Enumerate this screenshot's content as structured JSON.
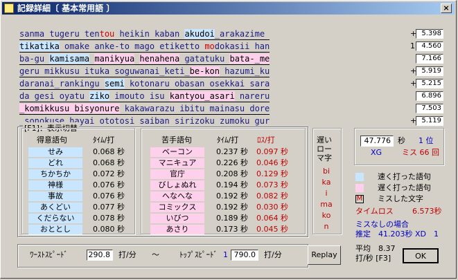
{
  "title": "記録詳細〔 基本常用語 〕",
  "close_glyph": "×",
  "rows": [
    {
      "segments": [
        {
          "t": "sanma tugeru ten",
          "c": "norm"
        },
        {
          "t": "tou",
          "c": "miss"
        },
        {
          "t": " heikin kaban ",
          "c": "norm"
        },
        {
          "t": "akudoi",
          "c": "fast"
        },
        {
          "t": "_arakazime ",
          "c": "norm"
        }
      ],
      "plus": "+",
      "value": "5.398"
    },
    {
      "segments": [
        {
          "t": "tikatika",
          "c": "fast"
        },
        {
          "t": " omake anke-to mago etiketto ",
          "c": "norm"
        },
        {
          "t": "mo",
          "c": "miss"
        },
        {
          "t": "dokasii han",
          "c": "norm"
        }
      ],
      "plus": "1",
      "value": "4.560"
    },
    {
      "segments": [
        {
          "t": "ba-gu ",
          "c": "norm"
        },
        {
          "t": "kamisama",
          "c": "fast"
        },
        {
          "t": " ",
          "c": "norm"
        },
        {
          "t": "manikyua",
          "c": "slow"
        },
        {
          "t": " ",
          "c": "norm"
        },
        {
          "t": "henahena",
          "c": "slow"
        },
        {
          "t": " gatatuku ",
          "c": "norm"
        },
        {
          "t": "bata-_me",
          "c": "slow"
        }
      ],
      "plus": "",
      "value": "7.166"
    },
    {
      "segments": [
        {
          "t": "geru mikkusu ituka soguwanai_keti_",
          "c": "norm"
        },
        {
          "t": "be-kon",
          "c": "slow"
        },
        {
          "t": " hazumi_ku",
          "c": "norm"
        }
      ],
      "plus": "+",
      "value": "5.919"
    },
    {
      "segments": [
        {
          "t": "daranai_rankingu ",
          "c": "norm"
        },
        {
          "t": "semi",
          "c": "fast"
        },
        {
          "t": " kotonaru obasan osekkai sara",
          "c": "norm"
        }
      ],
      "plus": "+",
      "value": "5.215"
    },
    {
      "segments": [
        {
          "t": "da gesi oyatu ",
          "c": "norm"
        },
        {
          "t": "ziko",
          "c": "fast"
        },
        {
          "t": " imouto isu ",
          "c": "norm"
        },
        {
          "t": "kantyou_asari",
          "c": "slow"
        },
        {
          "t": " nareru",
          "c": "norm"
        }
      ],
      "plus": "",
      "value": "6.896"
    },
    {
      "segments": [
        {
          "t": "_komikkusu bisyonure",
          "c": "slow"
        },
        {
          "t": " kakawarazu ibitu mainasu dore",
          "c": "norm"
        }
      ],
      "plus": "",
      "value": "7.503"
    },
    {
      "segments": [
        {
          "t": "_sonokuse hayai ototosi saiban sirizoku zumoku gur",
          "c": "norm"
        }
      ],
      "plus": "+",
      "value": "5.119"
    }
  ],
  "panel": {
    "label": "[F1]：表示切替",
    "good_header": "得意語句",
    "good_col": "ﾀｲﾑ/打",
    "good": [
      {
        "w": "せみ",
        "v": "0.068 秒"
      },
      {
        "w": "どれ",
        "v": "0.068 秒"
      },
      {
        "w": "ちかちか",
        "v": "0.072 秒"
      },
      {
        "w": "神様",
        "v": "0.076 秒"
      },
      {
        "w": "事故",
        "v": "0.076 秒"
      },
      {
        "w": "あくどい",
        "v": "0.077 秒"
      },
      {
        "w": "くだらない",
        "v": "0.078 秒"
      },
      {
        "w": "おととし",
        "v": "0.080 秒"
      }
    ],
    "bad_header": "苦手語句",
    "bad_col": "ﾀｲﾑ/打",
    "bad_loss_col": "ﾛｽ/打",
    "bad": [
      {
        "w": "ベーコン",
        "v": "0.237 秒",
        "l": "0.097 秒"
      },
      {
        "w": "マニキュア",
        "v": "0.226 秒",
        "l": "0.046 秒"
      },
      {
        "w": "官庁",
        "v": "0.208 秒",
        "l": "0.129 秒"
      },
      {
        "w": "びしょぬれ",
        "v": "0.194 秒",
        "l": "0.073 秒"
      },
      {
        "w": "へなへな",
        "v": "0.192 秒",
        "l": "0.082 秒"
      },
      {
        "w": "コミックス",
        "v": "0.192 秒",
        "l": "0.030 秒"
      },
      {
        "w": "いびつ",
        "v": "0.189 秒",
        "l": "0.064 秒"
      },
      {
        "w": "あさり",
        "v": "0.173 秒",
        "l": "0.045 秒"
      }
    ],
    "slow_keys_header": [
      "遅い",
      "ロー",
      "マ字"
    ],
    "slow_keys": [
      "bi",
      "ka",
      "i",
      "ma",
      "ko",
      "n"
    ]
  },
  "result": {
    "time": "47.776",
    "sec_unit": "秒",
    "rank": "1 位",
    "xg": "XG",
    "miss": "ミス 66 回"
  },
  "legend": {
    "fast": "速く打った語句",
    "slow": "遅く打った語句",
    "miss_mark": "M",
    "miss": "ミスした文字",
    "timeloss_label": "タイムロス",
    "timeloss_value": "6.573秒",
    "nomiss_label": "ミスなしの場合",
    "estimate": "推定　41.203秒 XD　1"
  },
  "speed": {
    "worst_label": "ﾜｰｽﾄｽﾋﾟｰﾄﾞ",
    "worst_value": "290.8",
    "unit": "打/分",
    "tilde": "～",
    "top_label": "ﾄｯﾌﾟｽﾋﾟｰﾄﾞ",
    "top_rank": "1",
    "top_value": "790.0"
  },
  "buttons": {
    "replay": "Replay",
    "ok": "OK"
  },
  "avg": {
    "line1": "平均　8.37",
    "line2": "打/秒 [F3]"
  }
}
